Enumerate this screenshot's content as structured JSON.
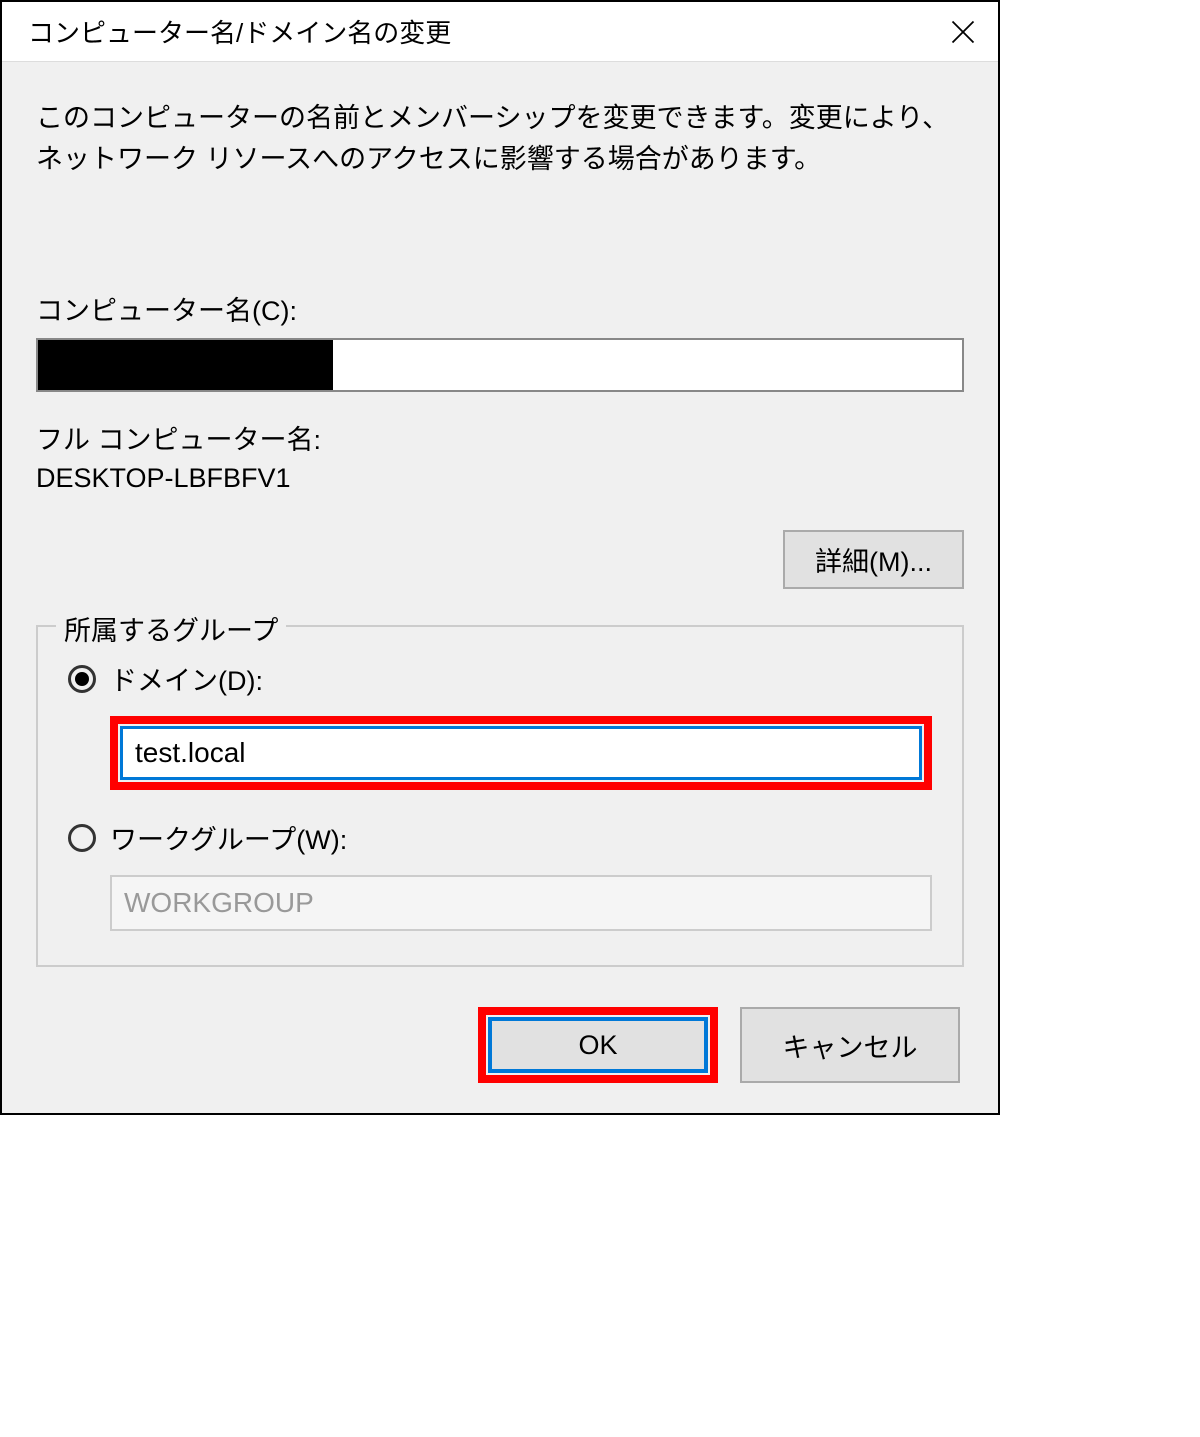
{
  "dialog": {
    "title": "コンピューター名/ドメイン名の変更",
    "description": "このコンピューターの名前とメンバーシップを変更できます。変更により、ネットワーク リソースへのアクセスに影響する場合があります。",
    "computer_name_label": "コンピューター名(C):",
    "computer_name_value": "",
    "full_name_label": "フル コンピューター名:",
    "full_name_value": "DESKTOP-LBFBFV1",
    "more_button": "詳細(M)...",
    "group": {
      "legend": "所属するグループ",
      "domain_label": "ドメイン(D):",
      "domain_value": "test.local",
      "domain_selected": true,
      "workgroup_label": "ワークグループ(W):",
      "workgroup_value": "WORKGROUP",
      "workgroup_selected": false
    },
    "ok_label": "OK",
    "cancel_label": "キャンセル"
  }
}
